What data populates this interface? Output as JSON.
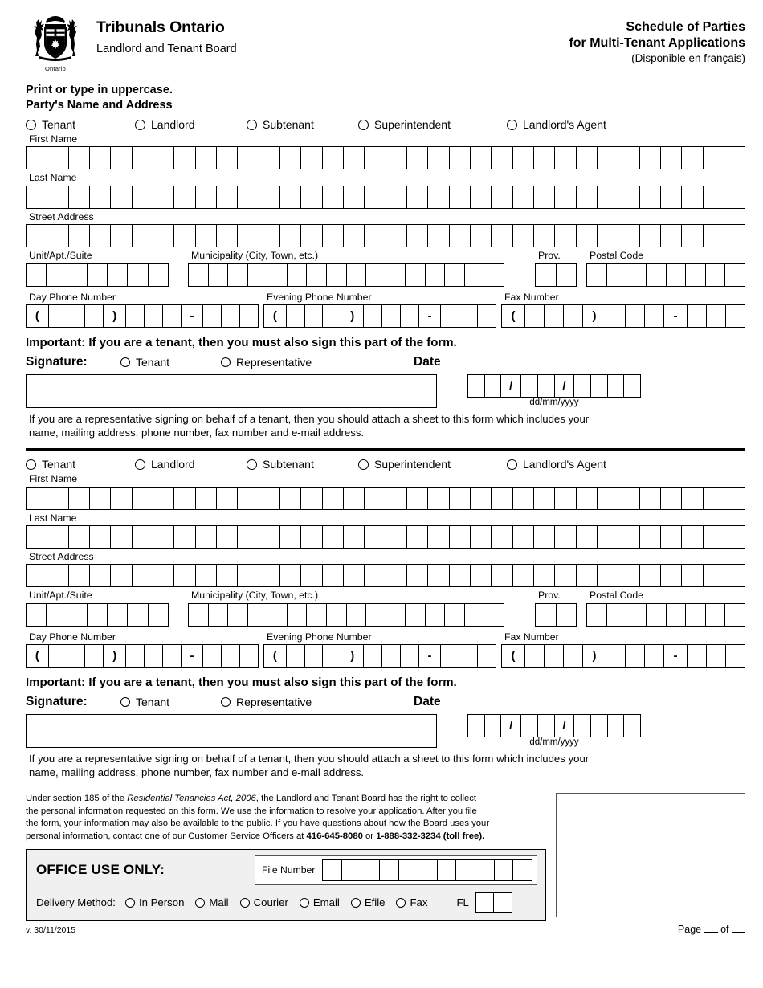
{
  "header": {
    "org_title": "Tribunals Ontario",
    "org_sub": "Landlord and Tenant Board",
    "crest_caption": "Ontario",
    "doc_title_line1": "Schedule of Parties",
    "doc_title_line2": "for Multi-Tenant Applications",
    "doc_french": "(Disponible en français)"
  },
  "instructions": {
    "line1": "Print or type in uppercase.",
    "line2": "Party's Name and Address"
  },
  "party_roles": [
    "Tenant",
    "Landlord",
    "Subtenant",
    "Superintendent",
    "Landlord's Agent"
  ],
  "field_labels": {
    "first_name": "First Name",
    "last_name": "Last Name",
    "street_address": "Street Address",
    "unit": "Unit/Apt./Suite",
    "municipality": "Municipality (City, Town, etc.)",
    "prov": "Prov.",
    "postal_code": "Postal Code",
    "day_phone": "Day Phone Number",
    "evening_phone": "Evening Phone Number",
    "fax": "Fax Number"
  },
  "box_counts": {
    "first_name": 34,
    "last_name": 34,
    "street_address": 34,
    "unit": 7,
    "municipality": 16,
    "prov": 2,
    "postal_code": 8,
    "phone": 12,
    "date": 10,
    "file_number": 11,
    "fl": 2
  },
  "phone_symbols": {
    "open": "(",
    "close": ")",
    "dash": "-"
  },
  "date_symbols": {
    "slash": "/"
  },
  "signature": {
    "important": "Important: If you are a tenant, then you must also sign this part of the form.",
    "label": "Signature:",
    "options": [
      "Tenant",
      "Representative"
    ],
    "date_label": "Date",
    "date_format": "dd/mm/yyyy",
    "note_line1": "If you are a representative signing on behalf of a tenant, then you should attach a sheet to this form which includes your",
    "note_line2": "name, mailing address, phone number, fax number and e-mail address."
  },
  "legal": {
    "l1a": "Under section 185 of the ",
    "l1b": "Residential Tenancies Act, 2006",
    "l1c": ", the Landlord and Tenant Board has the right to collect",
    "l2": "the personal information requested on this form. We use the information to resolve your application. After you file",
    "l3": "the form, your information may also be available to the public. If you have questions about how the Board uses your",
    "l4a": "personal information, contact one of our Customer Service Officers at ",
    "l4b": "416-645-8080",
    "l4c": " or ",
    "l4d": "1-888-332-3234 (toll free)."
  },
  "office": {
    "title": "OFFICE USE ONLY:",
    "file_number_label": "File Number",
    "delivery_label": "Delivery Method:",
    "delivery_options": [
      "In Person",
      "Mail",
      "Courier",
      "Email",
      "Efile",
      "Fax"
    ],
    "fl_label": "FL"
  },
  "footer": {
    "version": "v. 30/11/2015",
    "page_prefix": "Page",
    "page_mid": "of"
  }
}
